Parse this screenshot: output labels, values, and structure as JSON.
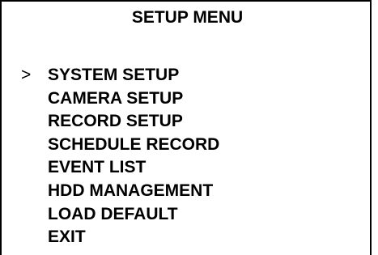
{
  "menu": {
    "title": "SETUP MENU",
    "cursor_symbol": ">",
    "selected_index": 0,
    "items": [
      {
        "label": "SYSTEM SETUP",
        "name": "system-setup"
      },
      {
        "label": "CAMERA SETUP",
        "name": "camera-setup"
      },
      {
        "label": "RECORD SETUP",
        "name": "record-setup"
      },
      {
        "label": "SCHEDULE RECORD",
        "name": "schedule-record"
      },
      {
        "label": "EVENT LIST",
        "name": "event-list"
      },
      {
        "label": "HDD MANAGEMENT",
        "name": "hdd-management"
      },
      {
        "label": "LOAD DEFAULT",
        "name": "load-default"
      },
      {
        "label": "EXIT",
        "name": "exit"
      }
    ]
  },
  "colors": {
    "background": "#ffffff",
    "text": "#000000",
    "border": "#000000"
  }
}
